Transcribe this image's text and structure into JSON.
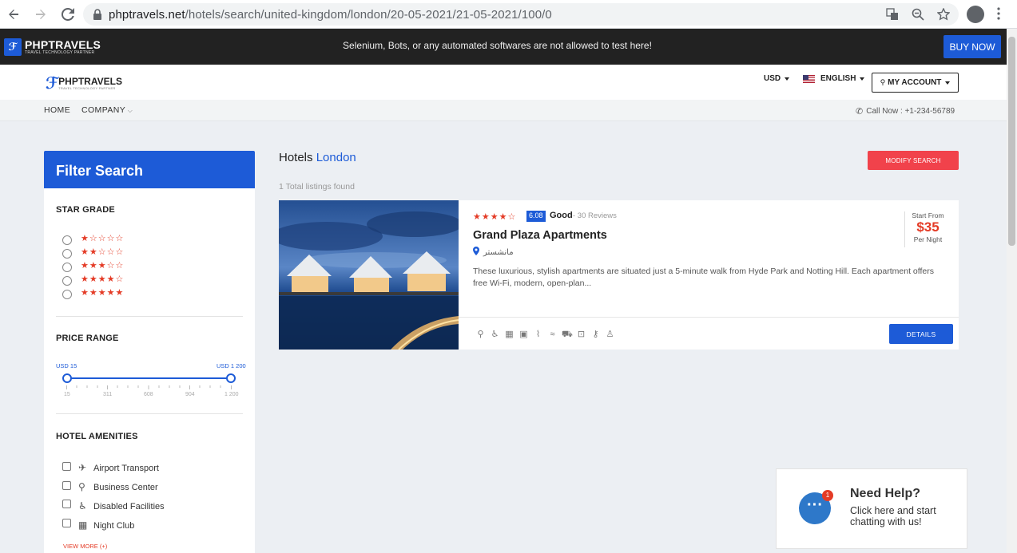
{
  "browser": {
    "url_host": "phptravels.net",
    "url_path": "/hotels/search/united-kingdom/london/20-05-2021/21-05-2021/100/0"
  },
  "topbar": {
    "logo_text": "PHPTRAVELS",
    "logo_sub": "TRAVEL TECHNOLOGY PARTNER",
    "warning": "Selenium, Bots, or any automated softwares are not allowed to test here!",
    "buy_now": "BUY NOW"
  },
  "header": {
    "logo_text": "PHPTRAVELS",
    "logo_sub": "TRAVEL TECHNOLOGY PARTNER",
    "currency": "USD",
    "language": "ENGLISH",
    "account": "MY ACCOUNT"
  },
  "subnav": {
    "home": "HOME",
    "company": "COMPANY",
    "call": "Call Now : +1-234-56789"
  },
  "sidebar": {
    "title": "Filter Search",
    "star_grade_title": "STAR GRADE",
    "star_options": [
      {
        "filled": 1,
        "display": "★☆☆☆☆"
      },
      {
        "filled": 2,
        "display": "★★☆☆☆"
      },
      {
        "filled": 3,
        "display": "★★★☆☆"
      },
      {
        "filled": 4,
        "display": "★★★★☆"
      },
      {
        "filled": 5,
        "display": "★★★★★"
      }
    ],
    "price_title": "PRICE RANGE",
    "price_min_label": "USD 15",
    "price_max_label": "USD 1 200",
    "price_ticks": [
      "15",
      "311",
      "608",
      "904",
      "1 200"
    ],
    "amenities_title": "HOTEL AMENITIES",
    "amenities": [
      {
        "label": "Airport Transport",
        "icon": "plane-icon"
      },
      {
        "label": "Business Center",
        "icon": "business-icon"
      },
      {
        "label": "Disabled Facilities",
        "icon": "wheelchair-icon"
      },
      {
        "label": "Night Club",
        "icon": "night-club-icon"
      }
    ],
    "view_more": "VIEW MORE (+)"
  },
  "main": {
    "title_prefix": "Hotels",
    "title_city": "London",
    "modify": "MODIFY SEARCH",
    "total": "1 Total listings found",
    "hotel": {
      "stars_display": "★★★★☆",
      "stars": 4,
      "score": "6.08",
      "score_label": "Good",
      "reviews": "- 30 Reviews",
      "name": "Grand Plaza Apartments",
      "location": "مانشستر",
      "description": "These luxurious, stylish apartments are situated just a 5-minute walk from Hyde Park and Notting Hill. Each apartment offers free Wi-Fi, modern, open-plan...",
      "start_from": "Start From",
      "price": "$35",
      "per_night": "Per Night",
      "details": "DETAILS"
    }
  },
  "help": {
    "badge": "1",
    "title": "Need Help?",
    "subtitle": "Click here and start chatting with us!"
  },
  "colors": {
    "primary": "#1d5bd7",
    "accent": "#e43b26",
    "modify": "#f1424b"
  }
}
